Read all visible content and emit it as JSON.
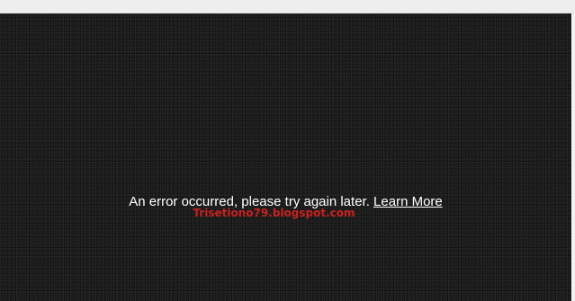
{
  "player": {
    "error_message": "An error occurred, please try again later.",
    "learn_more_label": "Learn More"
  },
  "overlay": {
    "watermark_text": "Trisetiono79.blogspot.com"
  },
  "colors": {
    "background": "#151515",
    "text": "#ffffff",
    "watermark": "#c9211e"
  }
}
